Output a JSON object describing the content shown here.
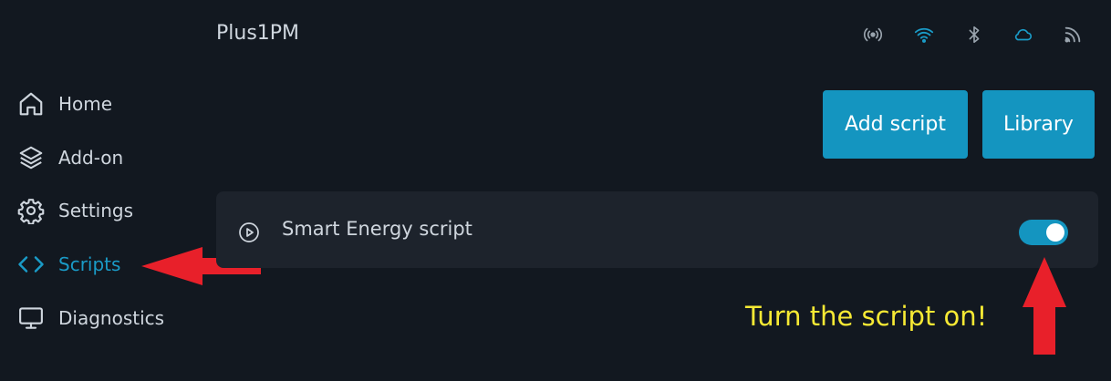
{
  "header": {
    "title": "Plus1PM",
    "status_icons": [
      "radio-icon",
      "wifi-icon",
      "bluetooth-icon",
      "cloud-icon",
      "rss-icon"
    ]
  },
  "sidebar": {
    "items": [
      {
        "label": "Home",
        "icon": "home-icon",
        "active": false
      },
      {
        "label": "Add-on",
        "icon": "layers-icon",
        "active": false
      },
      {
        "label": "Settings",
        "icon": "gear-icon",
        "active": false
      },
      {
        "label": "Scripts",
        "icon": "code-icon",
        "active": true
      },
      {
        "label": "Diagnostics",
        "icon": "monitor-icon",
        "active": false
      }
    ]
  },
  "toolbar": {
    "add_script_label": "Add script",
    "library_label": "Library"
  },
  "scripts": [
    {
      "name": "Smart Energy script",
      "enabled": true
    }
  ],
  "annotation": {
    "text": "Turn the script on!"
  },
  "colors": {
    "background": "#121820",
    "accent": "#1495c0",
    "annotation_arrow": "#e8202a",
    "annotation_text": "#f6e934"
  }
}
